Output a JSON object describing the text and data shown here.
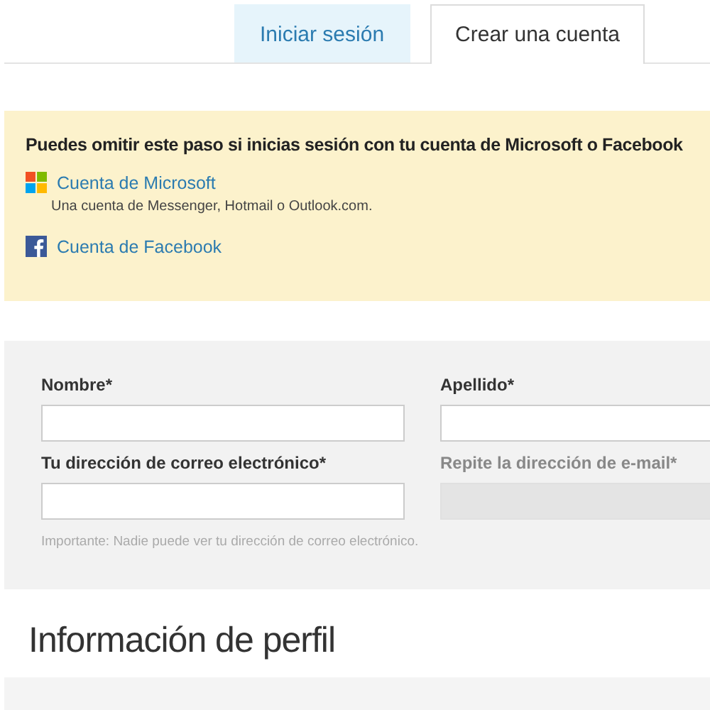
{
  "tabs": [
    {
      "label": "Iniciar sesión",
      "selected": false
    },
    {
      "label": "Crear una cuenta",
      "selected": true
    }
  ],
  "notice": {
    "heading": "Puedes omitir este paso si inicias sesión con tu cuenta de Microsoft o Facebook",
    "accounts": [
      {
        "kind": "microsoft",
        "label": "Cuenta de Microsoft",
        "description": "Una cuenta de Messenger, Hotmail o Outlook.com."
      },
      {
        "kind": "facebook",
        "label": "Cuenta de Facebook"
      }
    ]
  },
  "form": {
    "fields": [
      {
        "label": "Nombre*",
        "disabled": false
      },
      {
        "label": "Apellido*",
        "disabled": false
      },
      {
        "label": "Tu dirección de correo electrónico*",
        "disabled": false
      },
      {
        "label": "Repite la dirección de e-mail*",
        "disabled": true
      }
    ],
    "note": "Importante: Nadie puede ver tu dirección de correo electrónico."
  },
  "section_title": "Información de perfil"
}
